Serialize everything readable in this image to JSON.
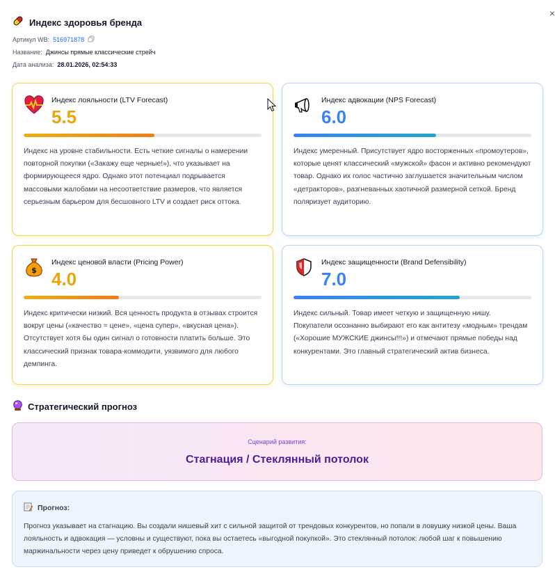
{
  "header": {
    "title": "Индекс здоровья бренда",
    "article_label": "Артикул WB:",
    "article_value": "516971878",
    "name_label": "Название:",
    "name_value": "Джинсы прямые классические стрейч",
    "date_label": "Дата анализа:",
    "date_value": "28.01.2026, 02:54:33"
  },
  "cards": [
    {
      "title": "Индекс лояльности (LTV Forecast)",
      "score": "5.5",
      "level": 0.55,
      "icon": "heart-pulse-icon",
      "text": "Индекс на уровне стабильности. Есть четкие сигналы о намерении повторной покупки («Закажу еще черные!»), что указывает на формирующееся ядро. Однако этот потенциал подрывается массовыми жалобами на несоответствие размеров, что является серьезным барьером для бесшовного LTV и создает риск оттока."
    },
    {
      "title": "Индекс адвокации (NPS Forecast)",
      "score": "6.0",
      "level": 0.6,
      "icon": "megaphone-icon",
      "text": "Индекс умеренный. Присутствует ядро восторженных «промоутеров», которые ценят классический «мужской» фасон и активно рекомендуют товар. Однако их голос частично заглушается значительным числом «детракторов», разгневанных хаотичной размерной сеткой. Бренд поляризует аудиторию."
    },
    {
      "title": "Индекс ценовой власти (Pricing Power)",
      "score": "4.0",
      "level": 0.4,
      "icon": "money-bag-icon",
      "text": "Индекс критически низкий. Вся ценность продукта в отзывах строится вокруг цены («качество = цене», «цена супер», «вкусная цена»). Отсутствует хотя бы один сигнал о готовности платить больше. Это классический признак товара-коммодити, уязвимого для любого демпинга."
    },
    {
      "title": "Индекс защищенности (Brand Defensibility)",
      "score": "7.0",
      "level": 0.7,
      "icon": "shield-icon",
      "text": "Индекс сильный. Товар имеет четкую и защищенную нишу. Покупатели осознанно выбирают его как антитезу «модным» трендам («Хорошие МУЖСКИЕ джинсы!!!») и отмечают прямые победы над конкурентами. Это главный стратегический актив бизнеса."
    }
  ],
  "strategy": {
    "title": "Стратегический прогноз",
    "scenario_label": "Сценарий развития:",
    "scenario_value": "Стагнация / Стеклянный потолок",
    "forecast_label": "Прогноз:",
    "forecast_text": "Прогноз указывает на стагнацию. Вы создали нишевый хит с сильной защитой от трендовых конкурентов, но попали в ловушку низкой цены. Ваша лояльность и адвокация — условны и существуют, пока вы остаетесь «выгодной покупкой». Это стеклянный потолок: любой шаг к повышению маржинальности через цену приведет к обрушению спроса."
  },
  "close_label": "×"
}
